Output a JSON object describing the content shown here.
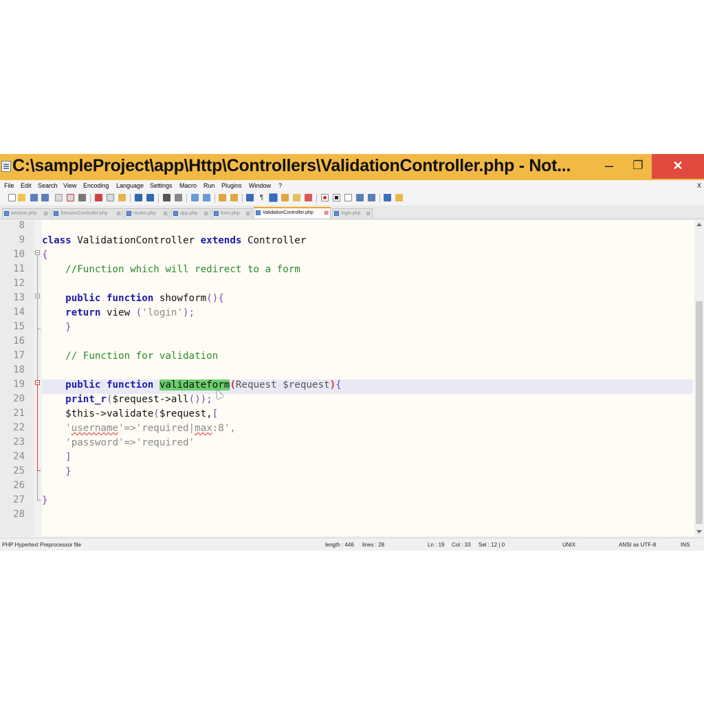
{
  "window": {
    "title": "C:\\sampleProject\\app\\Http\\Controllers\\ValidationController.php - Not...",
    "minimize": "–",
    "maximize": "❐",
    "close": "✕"
  },
  "menu": {
    "items": [
      "File",
      "Edit",
      "Search",
      "View",
      "Encoding",
      "Language",
      "Settings",
      "Macro",
      "Run",
      "Plugins",
      "Window",
      "?"
    ],
    "close_doc": "X"
  },
  "tabs": [
    {
      "label": "session.php",
      "active": false
    },
    {
      "label": "SessionController.php",
      "active": false
    },
    {
      "label": "routes.php",
      "active": false
    },
    {
      "label": "app.php",
      "active": false
    },
    {
      "label": "form.php",
      "active": false
    },
    {
      "label": "ValidationController.php",
      "active": true
    },
    {
      "label": "login.php",
      "active": false
    }
  ],
  "tab_close": "⊠",
  "editor": {
    "line_numbers": [
      "8",
      "9",
      "10",
      "11",
      "12",
      "13",
      "14",
      "15",
      "16",
      "17",
      "18",
      "19",
      "20",
      "21",
      "22",
      "23",
      "24",
      "25",
      "26",
      "27",
      "28"
    ],
    "code": {
      "l9_kw1": "class",
      "l9_name": " ValidationController ",
      "l9_kw2": "extends",
      "l9_parent": " Controller",
      "l10": "{",
      "l11": "    //Function which will redirect to a form",
      "l13_kw": "    public function",
      "l13_name": " showform",
      "l13_tail": "(){",
      "l14_kw": "    return",
      "l14_mid": " view ",
      "l14_po": "(",
      "l14_str": "'login'",
      "l14_end": ");",
      "l15": "    }",
      "l17": "    // Function for validation",
      "l19_kw": "    public function",
      "l19_sp": " ",
      "l19_name": "validateform",
      "l19_po": "(",
      "l19_args": "Request $request",
      "l19_pc": ")",
      "l19_brace": "{",
      "l20_kw": "    print_r",
      "l20_po": "(",
      "l20_mid": "$request->all",
      "l20_pp": "()",
      "l20_end": ");",
      "l21_a": "    $this->validate",
      "l21_po": "(",
      "l21_b": "$request,",
      "l21_c": "[",
      "l22_a": "    '",
      "l22_u": "username",
      "l22_b": "'=>'required|",
      "l22_m": "max",
      "l22_c": ":8',",
      "l23": "    'password'=>'required'",
      "l24": "    ]",
      "l25": "    }",
      "l27": "}"
    }
  },
  "status": {
    "file_type": "PHP Hypertext Preprocessor file",
    "length": "length : 446",
    "lines": "lines : 28",
    "ln": "Ln : 19",
    "col": "Col : 33",
    "sel": "Sel : 12 | 0",
    "eol": "UNIX",
    "encoding": "ANSI as UTF-8",
    "mode": "INS"
  },
  "colors": {
    "titlebar": "#f2ba45",
    "close_button": "#e04a3f",
    "keyword": "#1c1cae",
    "comment": "#2d8a2d",
    "selection": "#6ccf6c",
    "current_line": "#e9e9f6"
  }
}
